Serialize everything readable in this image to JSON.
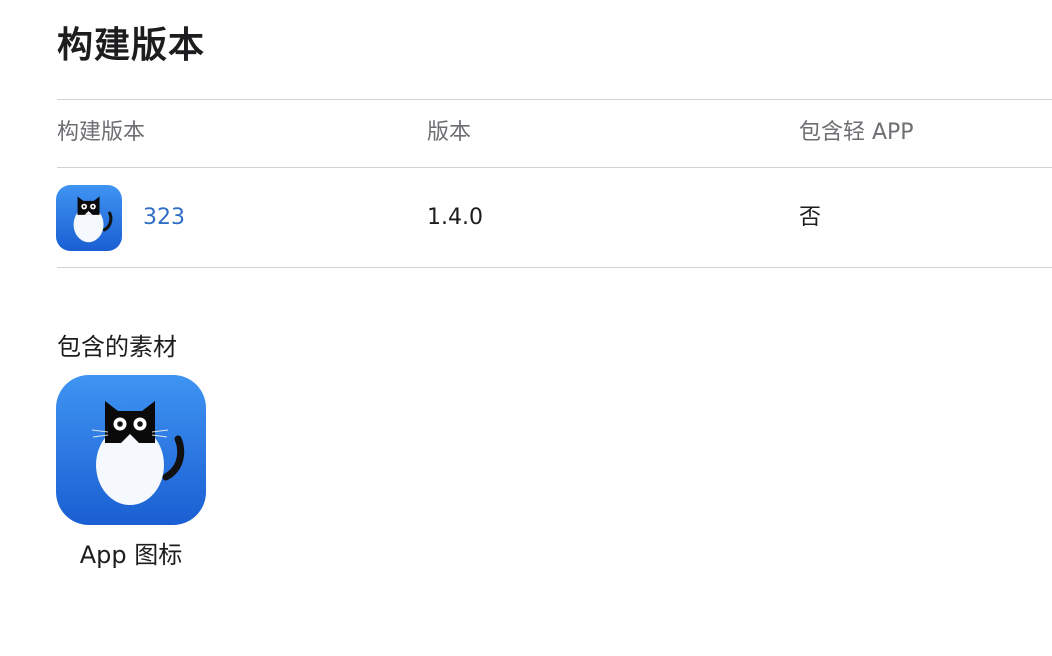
{
  "page": {
    "title": "构建版本"
  },
  "table": {
    "headers": {
      "build": "构建版本",
      "version": "版本",
      "includes_app_clip": "包含轻 APP"
    },
    "rows": [
      {
        "build": "323",
        "version": "1.4.0",
        "includes_app_clip": "否",
        "icon": "app-icon-cat"
      }
    ]
  },
  "assets": {
    "title": "包含的素材",
    "items": [
      {
        "label": "App 图标",
        "icon": "app-icon-cat"
      }
    ]
  },
  "colors": {
    "link": "#2f6fc5",
    "icon_blue_top": "#3b8ff0",
    "icon_blue_bottom": "#1c63d6",
    "divider": "#d2d2d7"
  }
}
